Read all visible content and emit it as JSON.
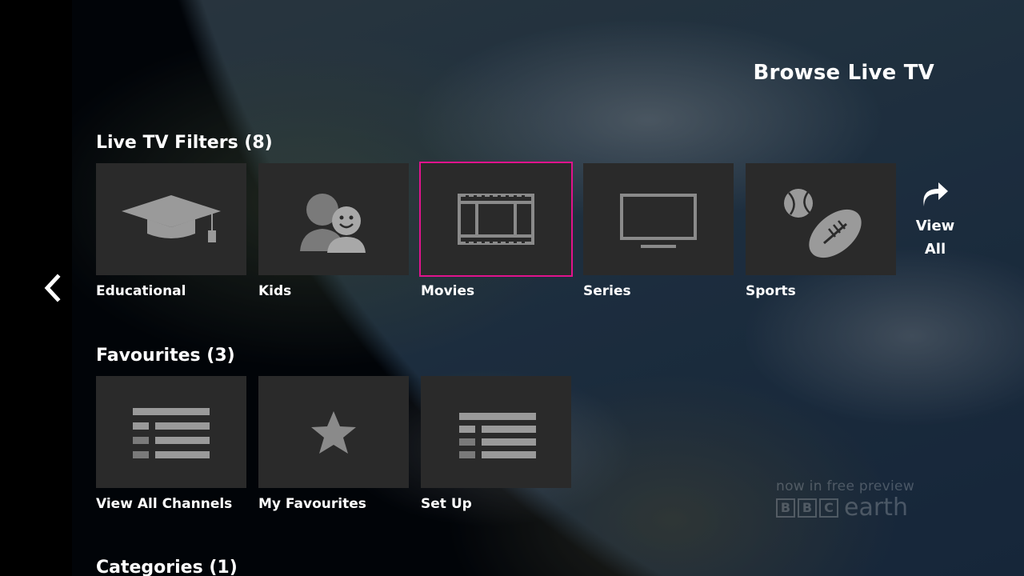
{
  "page": {
    "title": "Browse Live TV"
  },
  "sections": {
    "filters": {
      "title": "Live TV Filters (8)",
      "items": [
        {
          "label": "Educational",
          "icon": "graduation-cap-icon"
        },
        {
          "label": "Kids",
          "icon": "kids-icon"
        },
        {
          "label": "Movies",
          "icon": "film-strip-icon",
          "selected": true
        },
        {
          "label": "Series",
          "icon": "tv-icon"
        },
        {
          "label": "Sports",
          "icon": "sports-balls-icon"
        }
      ],
      "view_all": {
        "line1": "View",
        "line2": "All"
      }
    },
    "favourites": {
      "title": "Favourites (3)",
      "items": [
        {
          "label": "View All Channels",
          "icon": "channel-list-icon"
        },
        {
          "label": "My Favourites",
          "icon": "star-icon"
        },
        {
          "label": "Set Up",
          "icon": "setup-list-icon"
        }
      ]
    },
    "categories": {
      "title": "Categories (1)"
    }
  },
  "watermark": {
    "line1": "now in free preview",
    "letters": [
      "B",
      "B",
      "C"
    ],
    "word": "earth"
  },
  "colors": {
    "accent": "#e0138c",
    "tile": "#2a2a2a",
    "icon": "#9a9a9a"
  }
}
